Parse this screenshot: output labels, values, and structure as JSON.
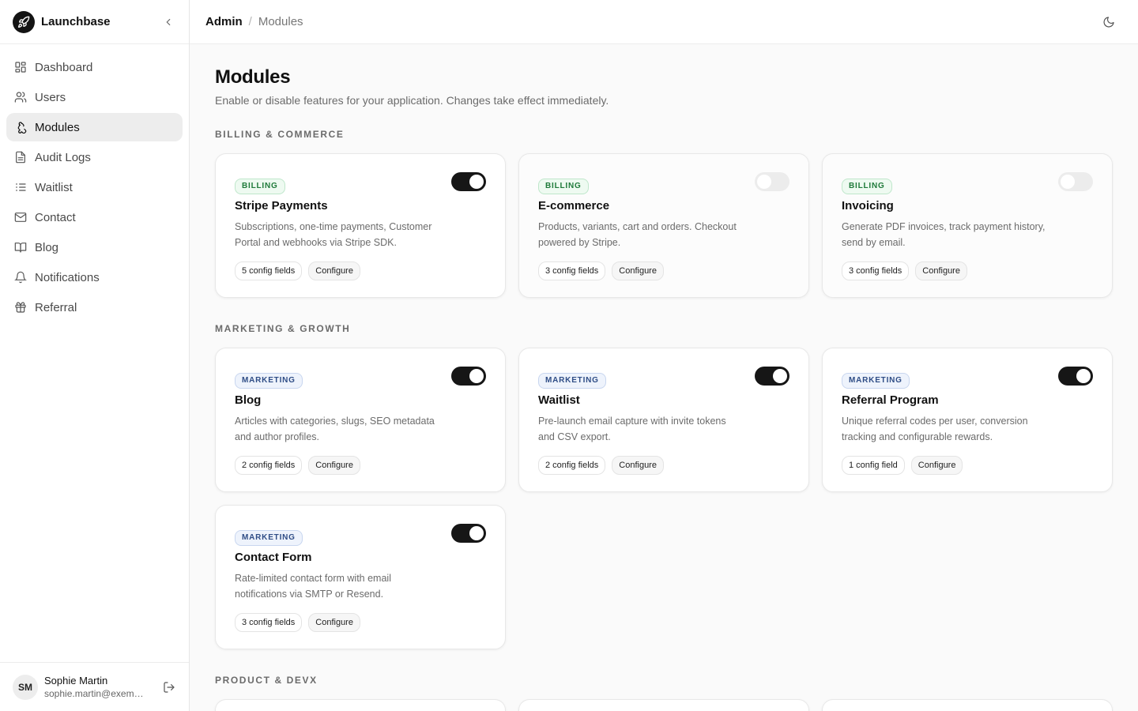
{
  "app": {
    "name": "Launchbase"
  },
  "sidebar": {
    "items": [
      {
        "label": "Dashboard",
        "icon": "dashboard-icon"
      },
      {
        "label": "Users",
        "icon": "users-icon"
      },
      {
        "label": "Modules",
        "icon": "puzzle-icon",
        "active": true
      },
      {
        "label": "Audit Logs",
        "icon": "file-text-icon"
      },
      {
        "label": "Waitlist",
        "icon": "list-icon"
      },
      {
        "label": "Contact",
        "icon": "mail-icon"
      },
      {
        "label": "Blog",
        "icon": "book-open-icon"
      },
      {
        "label": "Notifications",
        "icon": "bell-icon"
      },
      {
        "label": "Referral",
        "icon": "gift-icon"
      }
    ]
  },
  "user": {
    "initials": "SM",
    "name": "Sophie Martin",
    "email": "sophie.martin@exempl..."
  },
  "breadcrumb": {
    "root": "Admin",
    "separator": "/",
    "current": "Modules"
  },
  "page": {
    "title": "Modules",
    "subtitle": "Enable or disable features for your application. Changes take effect immediately."
  },
  "sections": [
    {
      "label": "BILLING & COMMERCE",
      "modules": [
        {
          "tag": "BILLING",
          "title": "Stripe Payments",
          "desc": "Subscriptions, one-time payments, Customer Portal and webhooks via Stripe SDK.",
          "config": "5 config fields",
          "configure": "Configure",
          "enabled": true
        },
        {
          "tag": "BILLING",
          "title": "E-commerce",
          "desc": "Products, variants, cart and orders. Checkout powered by Stripe.",
          "config": "3 config fields",
          "configure": "Configure",
          "enabled": false
        },
        {
          "tag": "BILLING",
          "title": "Invoicing",
          "desc": "Generate PDF invoices, track payment history, send by email.",
          "config": "3 config fields",
          "configure": "Configure",
          "enabled": false
        }
      ]
    },
    {
      "label": "MARKETING & GROWTH",
      "modules": [
        {
          "tag": "MARKETING",
          "title": "Blog",
          "desc": "Articles with categories, slugs, SEO metadata and author profiles.",
          "config": "2 config fields",
          "configure": "Configure",
          "enabled": true
        },
        {
          "tag": "MARKETING",
          "title": "Waitlist",
          "desc": "Pre-launch email capture with invite tokens and CSV export.",
          "config": "2 config fields",
          "configure": "Configure",
          "enabled": true
        },
        {
          "tag": "MARKETING",
          "title": "Referral Program",
          "desc": "Unique referral codes per user, conversion tracking and configurable rewards.",
          "config": "1 config field",
          "configure": "Configure",
          "enabled": true
        },
        {
          "tag": "MARKETING",
          "title": "Contact Form",
          "desc": "Rate-limited contact form with email notifications via SMTP or Resend.",
          "config": "3 config fields",
          "configure": "Configure",
          "enabled": true
        }
      ]
    },
    {
      "label": "PRODUCT & DEVX",
      "modules": []
    }
  ],
  "colors": {
    "accent": "#161616",
    "billing_tag": "#1f7a3a",
    "marketing_tag": "#2f4d86",
    "active_nav_bg": "#ededed"
  }
}
